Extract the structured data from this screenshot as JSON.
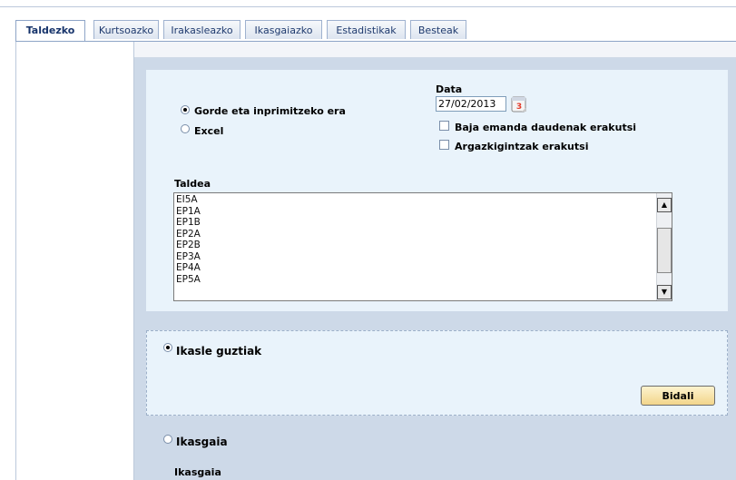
{
  "tabs": [
    {
      "label": "Taldezko",
      "active": true
    },
    {
      "label": "Kurtsoazko",
      "active": false
    },
    {
      "label": "Irakasleazko",
      "active": false
    },
    {
      "label": "Ikasgaiazko",
      "active": false
    },
    {
      "label": "Estadistikak",
      "active": false
    },
    {
      "label": "Besteak",
      "active": false
    }
  ],
  "output": {
    "options": [
      {
        "label": "Gorde eta inprimitzeko era",
        "selected": true
      },
      {
        "label": "Excel",
        "selected": false
      }
    ]
  },
  "date": {
    "label": "Data",
    "value": "27/02/2013",
    "calendar_icon": "calendar-icon",
    "calendar_icon_text": "3"
  },
  "checkboxes": [
    {
      "label": "Baja emanda daudenak erakutsi",
      "checked": false
    },
    {
      "label": "Argazkigintzak erakutsi",
      "checked": false
    }
  ],
  "group": {
    "label": "Taldea",
    "items": [
      "EI5A",
      "EP1A",
      "EP1B",
      "EP2A",
      "EP2B",
      "EP3A",
      "EP4A",
      "EP5A"
    ]
  },
  "scope": {
    "all_students": {
      "label": "Ikasle guztiak",
      "selected": true
    },
    "subject": {
      "label": "Ikasgaia",
      "selected": false
    },
    "subject_field_label": "Ikasgaia"
  },
  "submit_label": "Bidali",
  "colors": {
    "accent": "#1f3a6e",
    "panel": "#e9f3fb",
    "main_bg": "#cdd9e8",
    "button": "#f2d58a"
  }
}
